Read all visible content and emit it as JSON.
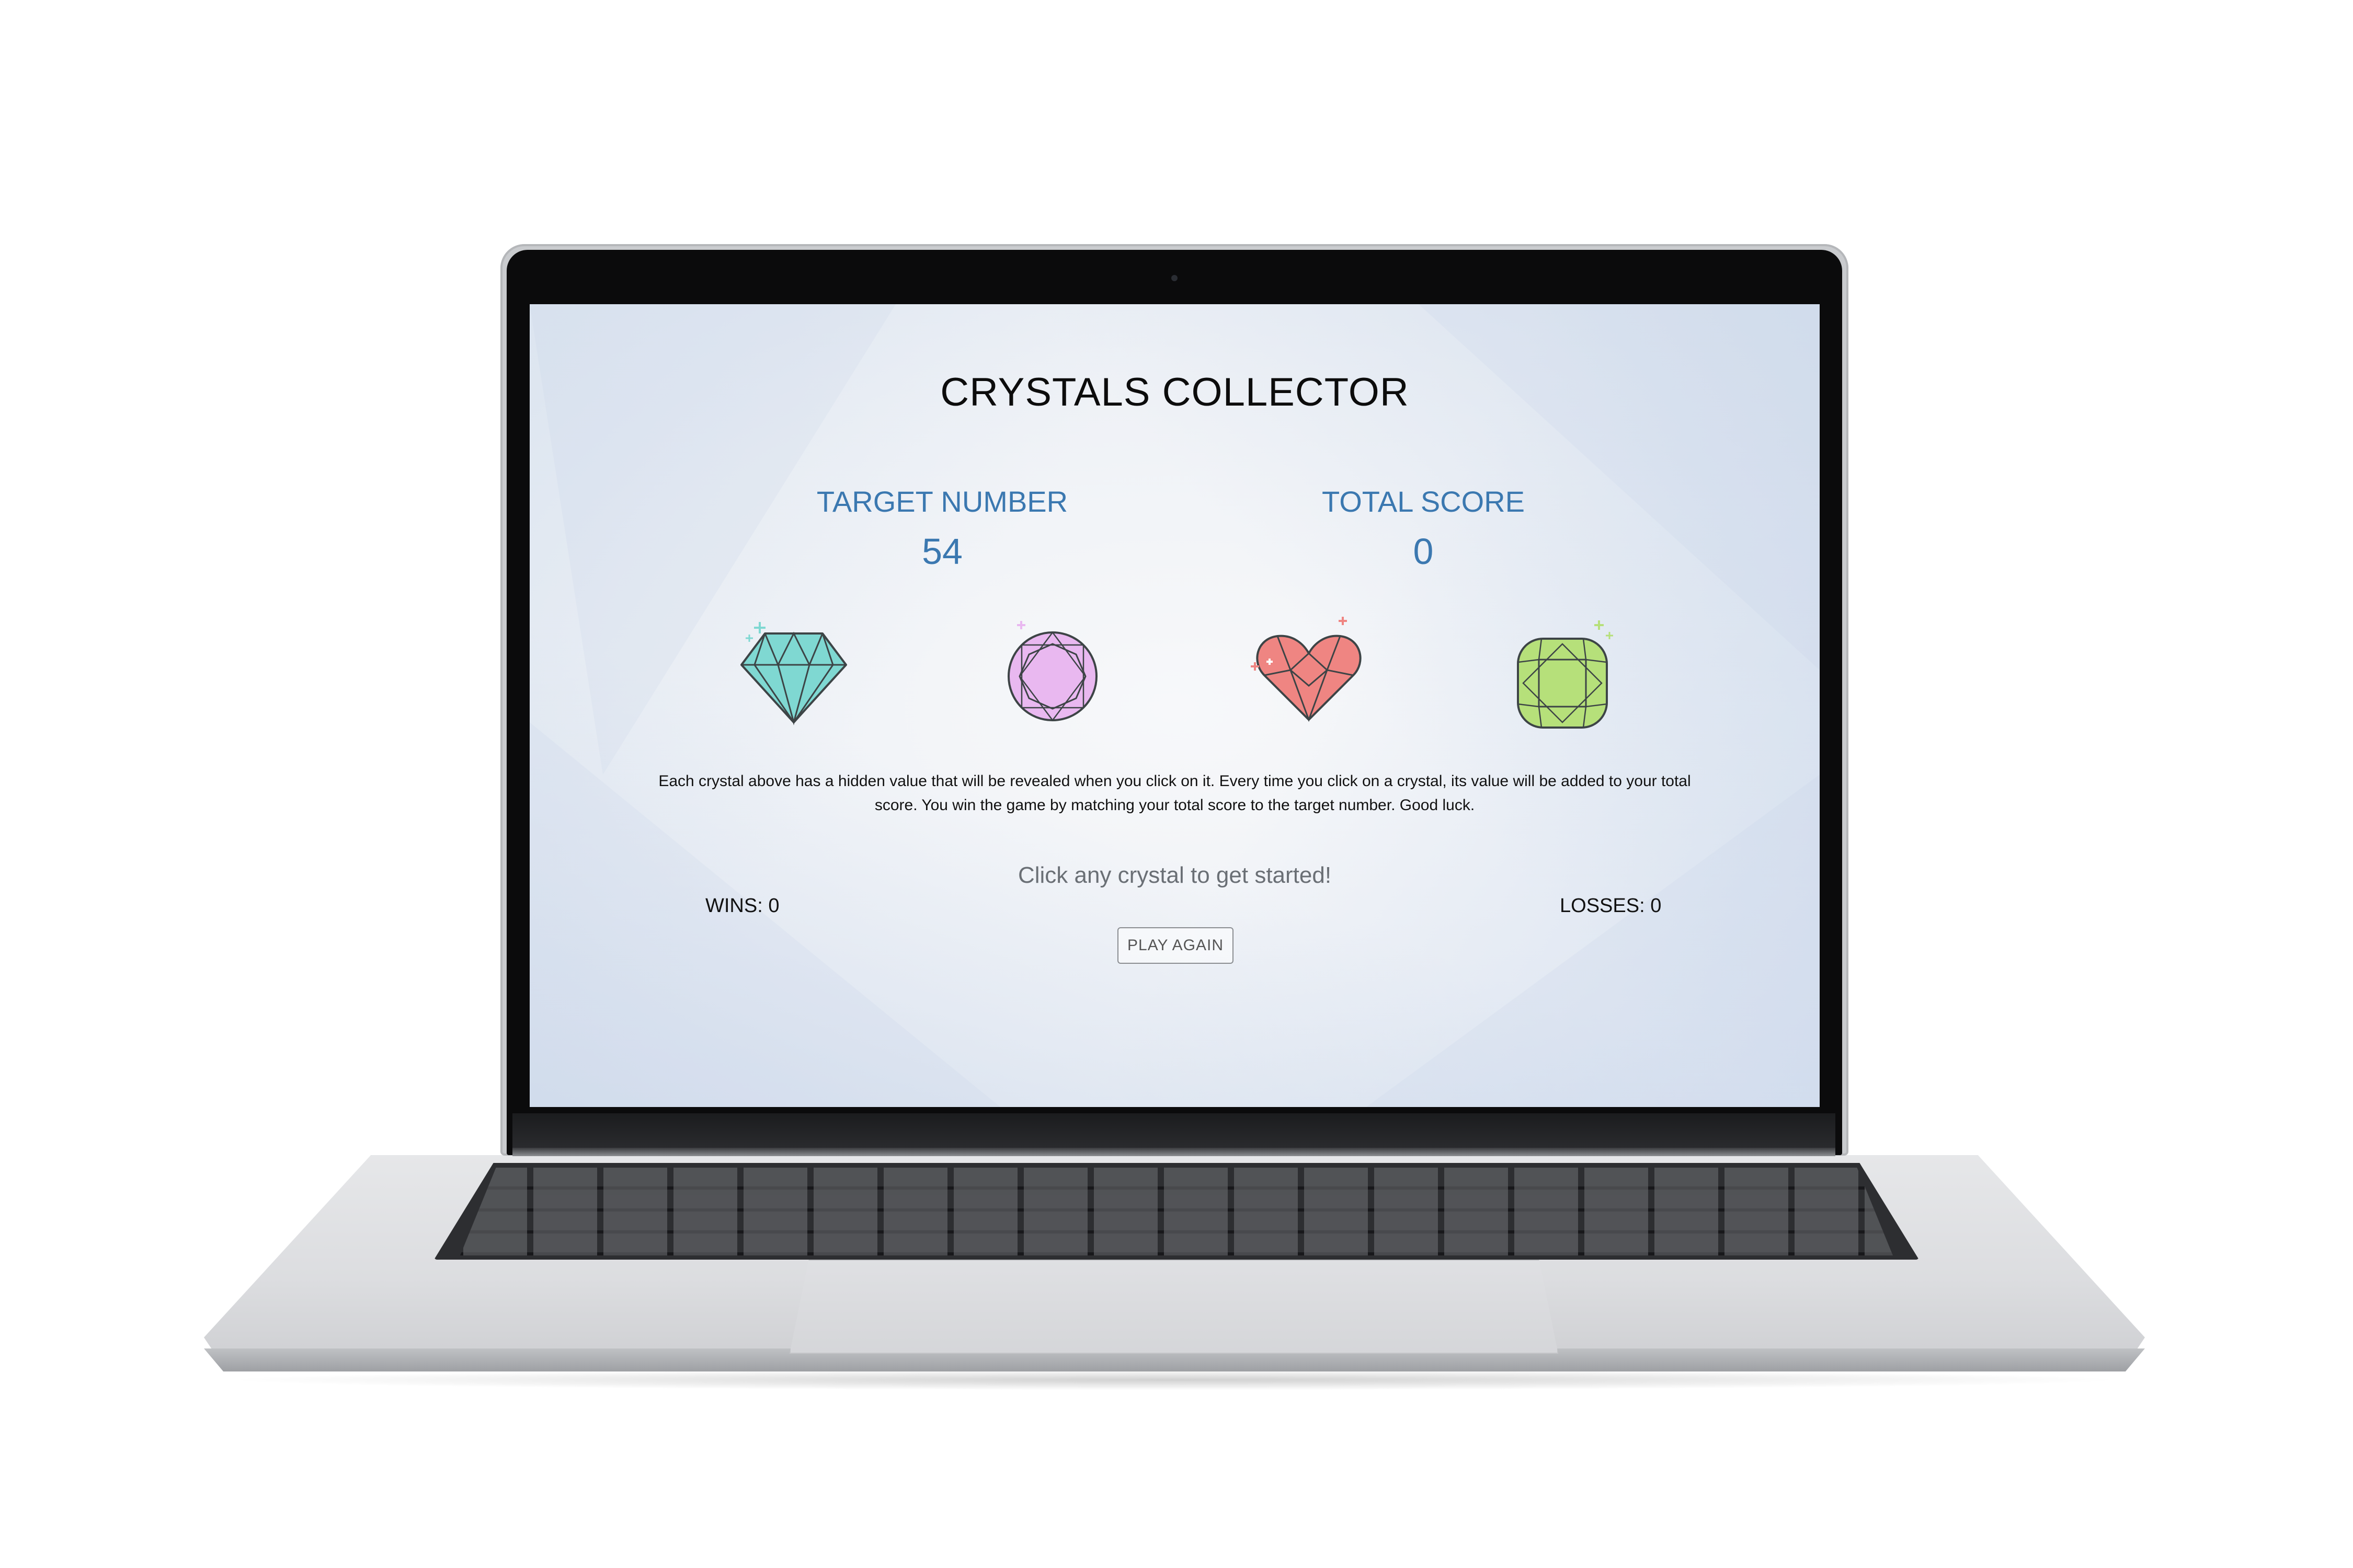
{
  "game": {
    "title": "CRYSTALS COLLECTOR",
    "target_label": "TARGET NUMBER",
    "target_value": "54",
    "score_label": "TOTAL SCORE",
    "score_value": "0",
    "crystals": [
      {
        "name": "diamond",
        "icon": "diamond-crystal-icon",
        "color": "#7fd8d2"
      },
      {
        "name": "round",
        "icon": "round-crystal-icon",
        "color": "#e9b8f0"
      },
      {
        "name": "heart",
        "icon": "heart-crystal-icon",
        "color": "#ef8582"
      },
      {
        "name": "cushion",
        "icon": "cushion-crystal-icon",
        "color": "#b6e07a"
      }
    ],
    "description": "Each crystal above has a hidden value that will be revealed when you click on it. Every time you click on a crystal, its value will be added to your total score. You win the game by matching your total score to the target number. Good luck.",
    "status_message": "Click any crystal to get started!",
    "wins_text": "WINS: 0",
    "losses_text": "LOSSES: 0",
    "play_again_label": "PLAY AGAIN"
  },
  "colors": {
    "accent": "#3b78b0",
    "title": "#0c0c0c",
    "status_text": "#6a6f75"
  }
}
